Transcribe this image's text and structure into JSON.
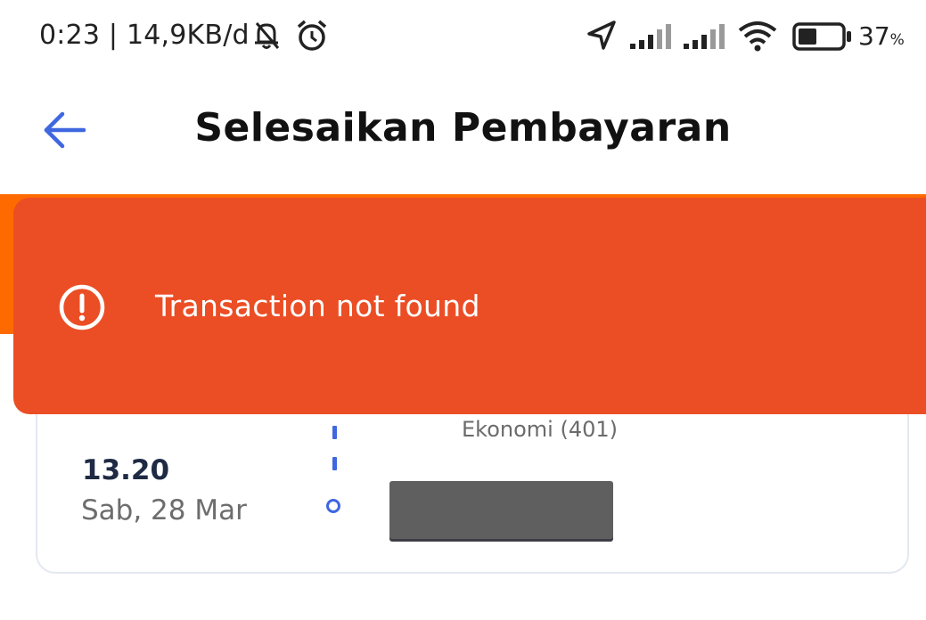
{
  "status_bar": {
    "time_and_speed": "0:23 | 14,9KB/d",
    "battery_percent": "37",
    "battery_unit": "%",
    "icons": [
      "notifications-off-icon",
      "alarm-icon",
      "location-icon",
      "signal-icon",
      "signal-icon",
      "wifi-icon",
      "battery-icon"
    ]
  },
  "header": {
    "title": "Selesaikan Pembayaran",
    "back_icon": "arrow-left-icon"
  },
  "toast": {
    "message": "Transaction not found",
    "icon": "alert-circle-icon"
  },
  "trip": {
    "class_label": "Ekonomi (401)",
    "departure_time": "13.20",
    "departure_date": "Sab, 28 Mar"
  },
  "colors": {
    "accent_blue": "#3f67e0",
    "toast_red": "#eb4e25",
    "brand_orange": "#ff6a00",
    "title_dark": "#111111"
  }
}
